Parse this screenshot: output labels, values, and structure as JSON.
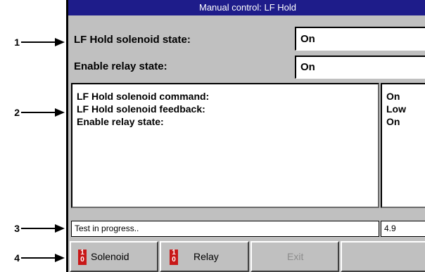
{
  "callouts": [
    "1",
    "2",
    "3",
    "4"
  ],
  "window": {
    "title": "Manual control: LF Hold"
  },
  "top_rows": [
    {
      "label": "LF Hold solenoid state:",
      "value": "On"
    },
    {
      "label": "Enable relay state:",
      "value": "On"
    }
  ],
  "details": [
    {
      "label": "LF Hold solenoid command:",
      "value": "On"
    },
    {
      "label": "LF Hold solenoid feedback:",
      "value": "Low"
    },
    {
      "label": "Enable relay state:",
      "value": "On"
    }
  ],
  "status": {
    "message": "Test in progress..",
    "value": "4.9"
  },
  "buttons": [
    {
      "label": "Solenoid",
      "icon": "toggle-1-0-icon",
      "enabled": true
    },
    {
      "label": "Relay",
      "icon": "toggle-1-0-icon",
      "enabled": true
    },
    {
      "label": "Exit",
      "enabled": false
    },
    {
      "label": "",
      "enabled": false
    }
  ],
  "colors": {
    "titlebar": "#1e1c8a",
    "window_bg": "#c0c0c0",
    "toggle_icon": "#c81818"
  }
}
